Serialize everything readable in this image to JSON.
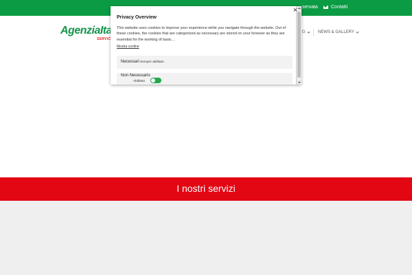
{
  "topbar": {
    "reserved_link": "servata",
    "contact_link": "Contatti"
  },
  "header": {
    "logo_main": "AgenziaIta",
    "logo_sub": "SERVIC",
    "nav_items": [
      {
        "label": "G"
      },
      {
        "label": "NEWS & GALLERY"
      }
    ]
  },
  "banner": {
    "title": "I nostri servizi"
  },
  "cookie_modal": {
    "title": "Privacy Overview",
    "body": "This website uses cookies to improve your experience while you navigate through the website. Out of these cookies, the cookies that are categorized as necessary are stored on your browser as they are essential for the working of basic...",
    "show_more": "Mostra conline",
    "categories": [
      {
        "name": "Necessari",
        "status": "Sempre abilitato"
      },
      {
        "name": "Non Necessario",
        "status": "Abilitato",
        "enabled": true
      }
    ]
  },
  "colors": {
    "green": "#0b9b44",
    "red": "#e30613",
    "toggle_on": "#22a84a"
  }
}
